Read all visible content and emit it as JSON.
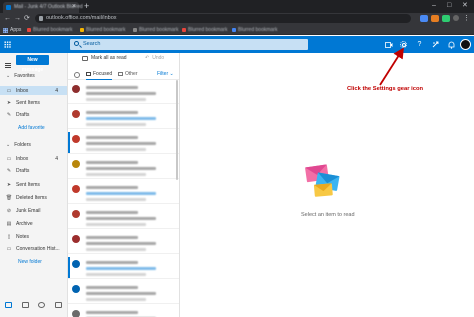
{
  "browser": {
    "tab_title": "Mail - Junk 4/7 Outlook Blurred",
    "tab_close": "×",
    "new_tab": "+",
    "window_min": "–",
    "window_max": "□",
    "window_close": "✕",
    "back": "←",
    "forward": "→",
    "reload": "⟳",
    "url": "outlook.office.com/mail/inbox",
    "menu": "⋮",
    "apps_label": "Apps",
    "bookmarks": [
      {
        "label": "Blurred bookmark",
        "color": "#e8453c"
      },
      {
        "label": "Blurred bookmark",
        "color": "#f4b400"
      },
      {
        "label": "Blurred bookmark",
        "color": "#888888"
      },
      {
        "label": "Blurred bookmark",
        "color": "#e8453c"
      },
      {
        "label": "Blurred bookmark",
        "color": "#4285f4"
      }
    ]
  },
  "header": {
    "search_placeholder": "Search",
    "help_glyph": "?",
    "bell_glyph": "🔔",
    "accent": "#0078d4"
  },
  "nav": {
    "new_message": "New message",
    "favorites_label": "Favorites",
    "favorites": [
      {
        "icon": "inbox-icon",
        "glyph": "▭",
        "label": "Inbox",
        "count": "4",
        "selected": true
      },
      {
        "icon": "sent-icon",
        "glyph": "➤",
        "label": "Sent Items",
        "count": ""
      },
      {
        "icon": "drafts-icon",
        "glyph": "✎",
        "label": "Drafts",
        "count": ""
      }
    ],
    "add_favorite": "Add favorite",
    "folders_label": "Folders",
    "folders": [
      {
        "icon": "inbox-icon",
        "glyph": "▭",
        "label": "Inbox",
        "count": "4"
      },
      {
        "icon": "drafts-icon",
        "glyph": "✎",
        "label": "Drafts",
        "count": ""
      },
      {
        "icon": "sent-icon",
        "glyph": "➤",
        "label": "Sent Items",
        "count": ""
      },
      {
        "icon": "trash-icon",
        "glyph": "🗑",
        "label": "Deleted Items",
        "count": ""
      },
      {
        "icon": "junk-icon",
        "glyph": "⊘",
        "label": "Junk Email",
        "count": ""
      },
      {
        "icon": "archive-icon",
        "glyph": "▤",
        "label": "Archive",
        "count": ""
      },
      {
        "icon": "notes-icon",
        "glyph": "▯",
        "label": "Notes",
        "count": ""
      },
      {
        "icon": "folder-icon",
        "glyph": "▭",
        "label": "Conversation Hist...",
        "count": ""
      }
    ],
    "new_folder": "New folder"
  },
  "list": {
    "mark_all_read": "Mark all as read",
    "undo": "Undo",
    "tab_focused": "Focused",
    "tab_other": "Other",
    "filter": "Filter ⌄",
    "avatar_colors": [
      "#8e2e2e",
      "#b03a2e",
      "#c0392b",
      "#b8860b",
      "#c0392b",
      "#b03a2e",
      "#9b2d2d",
      "#0063b1",
      "#0063b1",
      "#6b6b6b"
    ],
    "unread_rows": [
      2,
      7
    ]
  },
  "reading": {
    "empty_text": "Select an item to read",
    "annotation": "Click the Settings gear icon",
    "annotation_color": "#c00000"
  }
}
